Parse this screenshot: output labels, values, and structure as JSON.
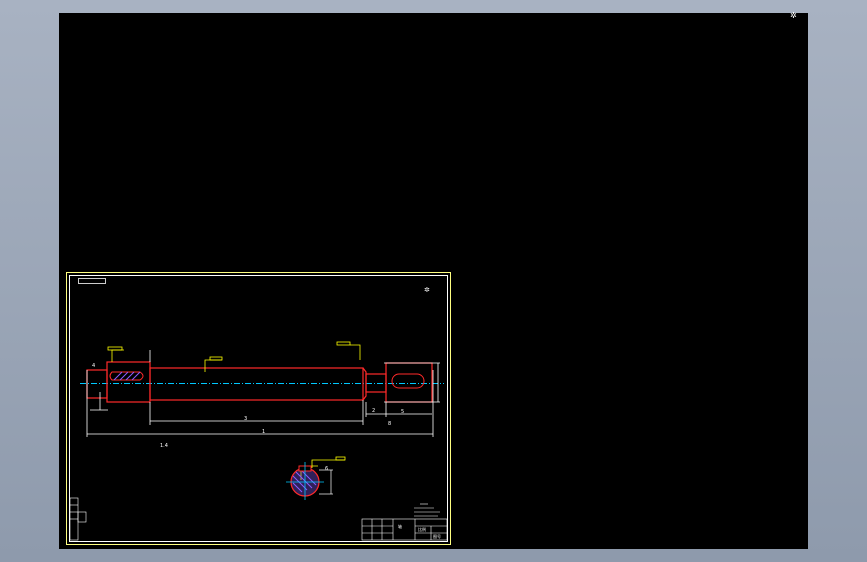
{
  "viewport": {
    "background": "#000000",
    "corner_symbol": "✲",
    "sheet_symbol": "✲"
  },
  "colors": {
    "sheet_frame": "#ffff80",
    "outline": "#ff2a2a",
    "centerline": "#00c8ff",
    "dimension": "#ffffff",
    "leader": "#ffff00",
    "hatch": "#8a5cff"
  },
  "annotations": {
    "dim_small_left": "4",
    "dim_total": "1",
    "dim_mid": "3",
    "dim_b": "5",
    "dim_c": "2",
    "dim_d": "8",
    "dim_note": "1.4",
    "section_note": "6"
  },
  "title_block": {
    "label_a": "轴",
    "label_b": "比例",
    "label_c": "图号"
  }
}
